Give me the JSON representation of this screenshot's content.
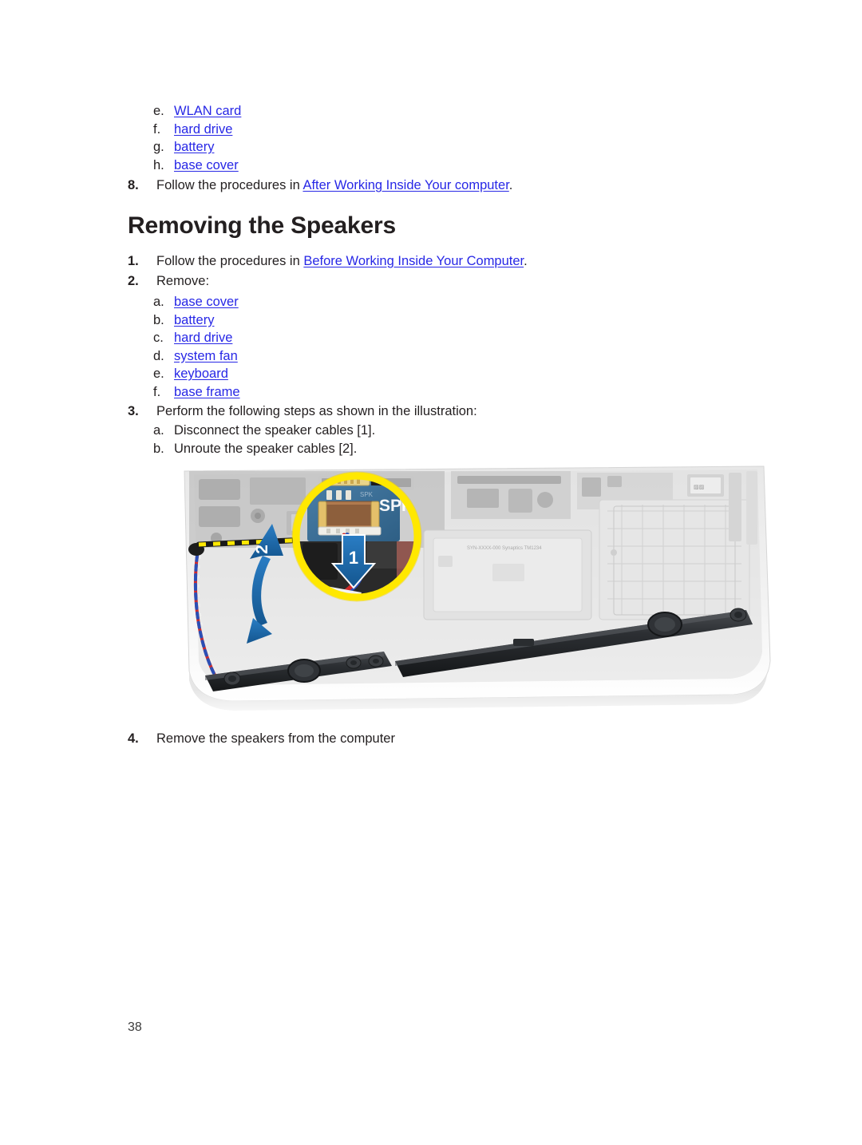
{
  "document": {
    "page_number": "38",
    "link_color": "#2727e6",
    "text_color": "#231f20"
  },
  "continued_list": {
    "items": [
      {
        "marker": "e.",
        "label": "WLAN card",
        "is_link": true
      },
      {
        "marker": "f.",
        "label": "hard drive",
        "is_link": true
      },
      {
        "marker": "g.",
        "label": "battery",
        "is_link": true
      },
      {
        "marker": "h.",
        "label": "base cover",
        "is_link": true
      }
    ]
  },
  "step8": {
    "marker": "8.",
    "text_before": "Follow the procedures in ",
    "link": "After Working Inside Your computer",
    "text_after": "."
  },
  "heading": {
    "title": "Removing the Speakers"
  },
  "step1": {
    "marker": "1.",
    "text_before": "Follow the procedures in ",
    "link": "Before Working Inside Your Computer",
    "text_after": "."
  },
  "step2": {
    "marker": "2.",
    "text": "Remove:"
  },
  "remove_list": {
    "items": [
      {
        "marker": "a.",
        "label": "base cover",
        "is_link": true
      },
      {
        "marker": "b.",
        "label": "battery",
        "is_link": true
      },
      {
        "marker": "c.",
        "label": "hard drive",
        "is_link": true
      },
      {
        "marker": "d.",
        "label": "system fan",
        "is_link": true
      },
      {
        "marker": "e.",
        "label": "keyboard",
        "is_link": true
      },
      {
        "marker": "f.",
        "label": "base frame",
        "is_link": true
      }
    ]
  },
  "step3": {
    "marker": "3.",
    "text": "Perform the following steps as shown in the illustration:",
    "substeps": [
      {
        "marker": "a.",
        "label": "Disconnect the speaker cables [1].",
        "is_link": false
      },
      {
        "marker": "b.",
        "label": "Unroute the speaker cables [2].",
        "is_link": false
      }
    ]
  },
  "step4": {
    "marker": "4.",
    "text": "Remove the speakers from the computer"
  },
  "illustration": {
    "alt": "Laptop base with speaker assembly, callout circle showing speaker cable connector",
    "callout_ring_color": "#ffe800",
    "arrow_color": "#1f6bb5",
    "callout_labels": [
      {
        "id": "1",
        "meaning": "disconnect-speaker-cable-connector"
      },
      {
        "id": "2",
        "meaning": "unroute-speaker-cables"
      }
    ],
    "board_label": "SPK",
    "board_label_small": "SPK"
  }
}
